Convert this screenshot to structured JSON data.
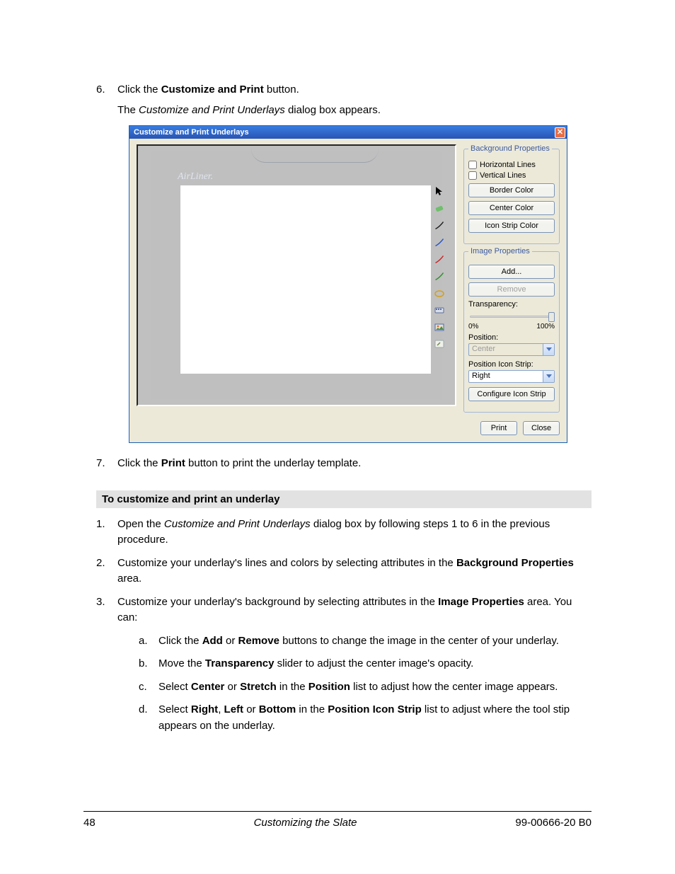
{
  "step6": {
    "num": "6.",
    "prefix": "Click the ",
    "bold": "Customize and Print",
    "suffix": " button."
  },
  "step6b": {
    "prefix": "The ",
    "italic": "Customize and Print Underlays",
    "suffix": " dialog box appears."
  },
  "dialog": {
    "title": "Customize and Print Underlays",
    "close": "✕",
    "airliner": "AirLiner.",
    "bg": {
      "legend": "Background Properties",
      "hlines": "Horizontal Lines",
      "vlines": "Vertical Lines",
      "border": "Border Color",
      "center": "Center Color",
      "strip": "Icon Strip Color"
    },
    "img": {
      "legend": "Image Properties",
      "add": "Add...",
      "remove": "Remove",
      "trans_label": "Transparency:",
      "p0": "0%",
      "p100": "100%",
      "pos_label": "Position:",
      "pos_val": "Center",
      "strip_label": "Position Icon Strip:",
      "strip_val": "Right",
      "config": "Configure Icon Strip"
    },
    "print": "Print",
    "close_btn": "Close"
  },
  "step7": {
    "num": "7.",
    "prefix": "Click the ",
    "bold": "Print",
    "suffix": " button to print the underlay template."
  },
  "heading": "To customize and print an underlay",
  "s1": {
    "num": "1.",
    "a": "Open the ",
    "i": "Customize and Print Underlays",
    "b": " dialog box by following steps 1 to 6 in the previous procedure."
  },
  "s2": {
    "num": "2.",
    "a": "Customize your underlay's lines and colors by selecting attributes in the ",
    "b1": "Background Properties",
    "b": " area."
  },
  "s3": {
    "num": "3.",
    "a": "Customize your underlay's background by selecting attributes in the ",
    "b1": "Image Properties",
    "b": " area. You can:"
  },
  "sa": {
    "sn": "a.",
    "a": "Click the ",
    "b1": "Add",
    "b": " or ",
    "b2": "Remove",
    "c": " buttons to change the image in the center of your underlay."
  },
  "sb": {
    "sn": "b.",
    "a": "Move the ",
    "b1": "Transparency",
    "b": " slider to adjust the center image's opacity."
  },
  "sc": {
    "sn": "c.",
    "a": "Select ",
    "b1": "Center",
    "b": " or ",
    "b2": "Stretch",
    "c": " in the ",
    "b3": "Position",
    "d": " list to adjust how the center image appears."
  },
  "sd": {
    "sn": "d.",
    "a": "Select ",
    "b1": "Right",
    "b": ", ",
    "b2": "Left",
    "c": " or ",
    "b3": "Bottom",
    "d": " in the ",
    "b4": "Position Icon Strip",
    "e": " list to adjust where the tool stip appears on the underlay."
  },
  "footer": {
    "left": "48",
    "center": "Customizing the Slate",
    "right": "99-00666-20 B0"
  }
}
